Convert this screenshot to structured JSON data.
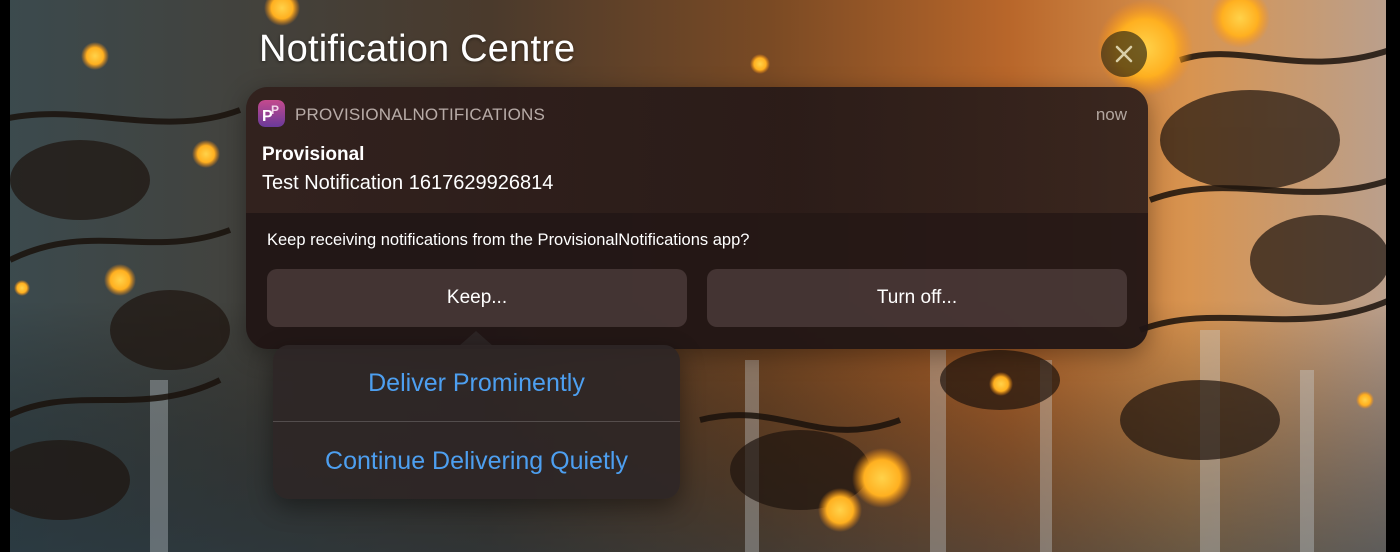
{
  "header": {
    "title": "Notification Centre"
  },
  "notification": {
    "app_name": "PROVISIONALNOTIFICATIONS",
    "time": "now",
    "title": "Provisional",
    "body": "Test Notification 1617629926814",
    "question": "Keep receiving notifications from the ProvisionalNotifications app?",
    "keep_label": "Keep...",
    "turn_off_label": "Turn off..."
  },
  "popover": {
    "options": [
      "Deliver Prominently",
      "Continue Delivering Quietly"
    ]
  },
  "colors": {
    "accent_link": "#4d9ff0",
    "app_icon_top": "#c44a8d",
    "app_icon_bottom": "#6a3a9a"
  },
  "icons": {
    "close": "close-icon",
    "app": "provisional-app-icon"
  }
}
